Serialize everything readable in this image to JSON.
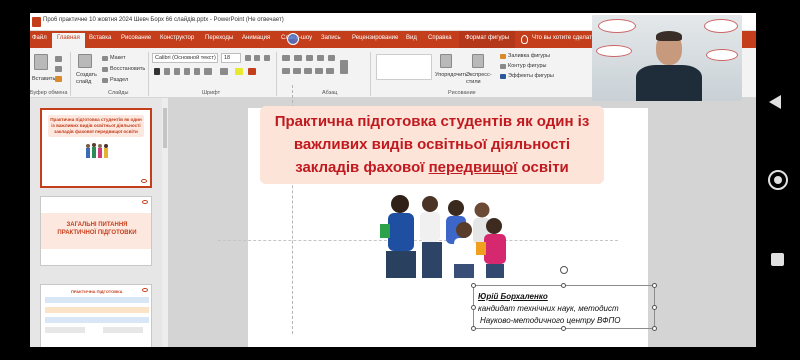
{
  "window": {
    "title": "Пpo6 практичне 10 жовтня 2024 Шевч Борх 66 слайдів.pptx - PowerPoint (Не отвечает)"
  },
  "tabs": {
    "file": "Файл",
    "home": "Главная",
    "insert": "Вставка",
    "draw": "Рисование",
    "designer": "Конструктор",
    "transitions": "Переходы",
    "animation": "Анимация",
    "slideshow": "Слайд-шоу",
    "record": "Запись",
    "review": "Рецензирование",
    "view": "Вид",
    "help": "Справка",
    "shape_format": "Формат фигуры",
    "tell_me": "Что вы хотите сделать?"
  },
  "ribbon": {
    "paste": "Вставить",
    "clipboard_group": "Буфер обмена",
    "new_slide": "Создать слайд",
    "layout": "Макет",
    "reset": "Восстановить",
    "section": "Раздел",
    "slides_group": "Слайды",
    "font_name": "Calibri (Основной текст)",
    "font_size": "18",
    "font_group": "Шрифт",
    "paragraph_group": "Абзац",
    "arrange": "Упорядочить",
    "quick_styles": "Экспресс-стили",
    "drawing_group": "Рисование",
    "shape_fill": "Заливка фигуры",
    "shape_outline": "Контур фигуры",
    "shape_effects": "Эффекты фигуры"
  },
  "thumbnails": [
    {
      "number": "",
      "title": "Практична підготовка студентів як один із важливих видів освітньої діяльності закладів фахової передвищої освіти",
      "active": true
    },
    {
      "number": "",
      "title": "ЗАГАЛЬНІ ПИТАННЯ ПРАКТИЧНОЇ ПІДГОТОВКИ",
      "active": false
    },
    {
      "number": "",
      "title": "ПРАКТИЧНА ПІДГОТОВКА",
      "active": false
    }
  ],
  "slide": {
    "title_part1": "Практична підготовка студентів як один із важливих видів освітньої діяльності закладів фахової ",
    "title_underlined": "передвищої",
    "title_part2": " освіти",
    "author_name": "Юрій Борхаленко",
    "author_line1": "кандидат технічних наук, методист",
    "author_line2": "Науково-методичного центру ВФПО"
  },
  "colors": {
    "accent": "#c43e1c",
    "title_red": "#c0191f",
    "title_bg": "#fce4d8"
  }
}
